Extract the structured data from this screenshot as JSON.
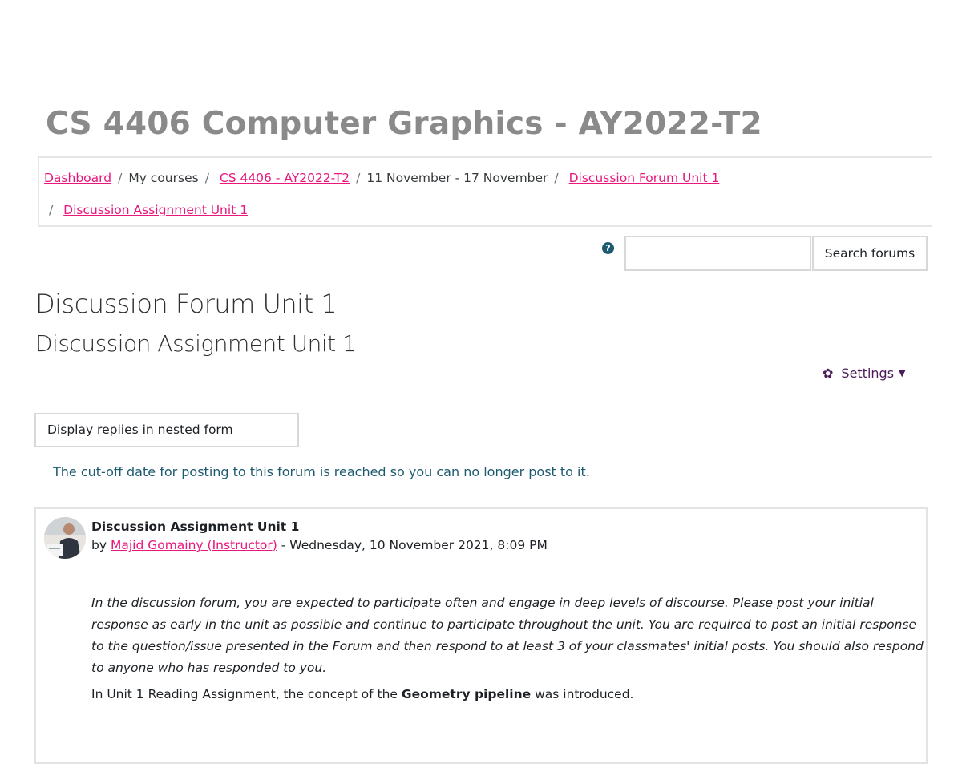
{
  "course_title": "CS 4406 Computer Graphics - AY2022-T2",
  "breadcrumb": {
    "dashboard": "Dashboard",
    "my_courses": "My courses",
    "course": "CS 4406 - AY2022-T2",
    "week": "11 November - 17 November",
    "forum": "Discussion Forum Unit 1",
    "discussion": "Discussion Assignment Unit 1",
    "separator": "/"
  },
  "search": {
    "placeholder": "",
    "value": "",
    "button_label": "Search forums",
    "help_icon": "question-circle-icon"
  },
  "page": {
    "heading": "Discussion Forum Unit 1",
    "subheading": "Discussion Assignment Unit 1"
  },
  "settings": {
    "label": "Settings",
    "icon": "gear-icon"
  },
  "display_mode": {
    "selected": "Display replies in nested form"
  },
  "notice": "The cut-off date for posting to this forum is reached so you can no longer post to it.",
  "post": {
    "subject": "Discussion Assignment Unit 1",
    "by_prefix": "by",
    "author": "Majid Gomainy (Instructor)",
    "date": "- Wednesday, 10 November 2021, 8:09 PM",
    "body_italic": "In the discussion forum, you are expected to participate often and engage in deep levels of discourse.  Please post your initial response as early in the unit as possible and continue to participate throughout the unit. You are required to post an initial response to the question/issue presented in the Forum and then respond to at least 3 of your classmates' initial posts.  You should also respond to anyone who has responded to you.",
    "body_line_prefix": "In Unit 1 Reading Assignment, the concept of the ",
    "body_line_bold": "Geometry pipeline",
    "body_line_suffix": " was introduced."
  },
  "colors": {
    "link": "#e8167d",
    "notice": "#1c5a70",
    "settings": "#4b1c5b",
    "title_gray": "#8a8a8a"
  }
}
